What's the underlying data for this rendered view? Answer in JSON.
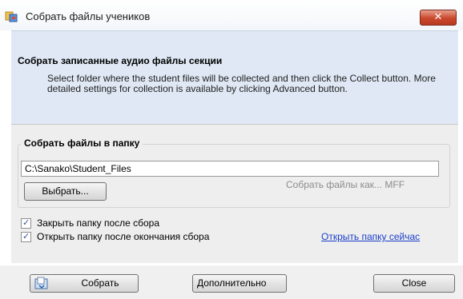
{
  "window": {
    "title": "Собрать файлы учеников",
    "close_glyph": "✕"
  },
  "header": {
    "title": "Собрать записанные аудио файлы секции",
    "description": "Select folder where the student files will be collected and then click the Collect button. More detailed settings for collection is available by clicking Advanced button."
  },
  "folder_group": {
    "label": "Собрать файлы в папку",
    "path_value": "C:\\Sanako\\Student_Files",
    "browse_label": "Выбрать...",
    "collect_as_label": "Собрать файлы как... MFF"
  },
  "options": {
    "close_after": {
      "label": "Закрыть папку после сбора",
      "checked": true
    },
    "open_after": {
      "label": "Открыть папку после окончания сбора",
      "checked": true
    },
    "open_now_link": "Открыть папку сейчас"
  },
  "buttons": {
    "collect_label": "Собрать",
    "advanced_label": "Дополнительно",
    "close_label": "Close"
  },
  "icons": {
    "app": "sanako-app-icon",
    "collect": "collect-folder-icon",
    "checkbox_mark": "✓"
  },
  "colors": {
    "header_bg": "#dfe8f4",
    "panel_bg": "#eeeeee",
    "link": "#1a3ec8",
    "close_red": "#c9472d"
  }
}
